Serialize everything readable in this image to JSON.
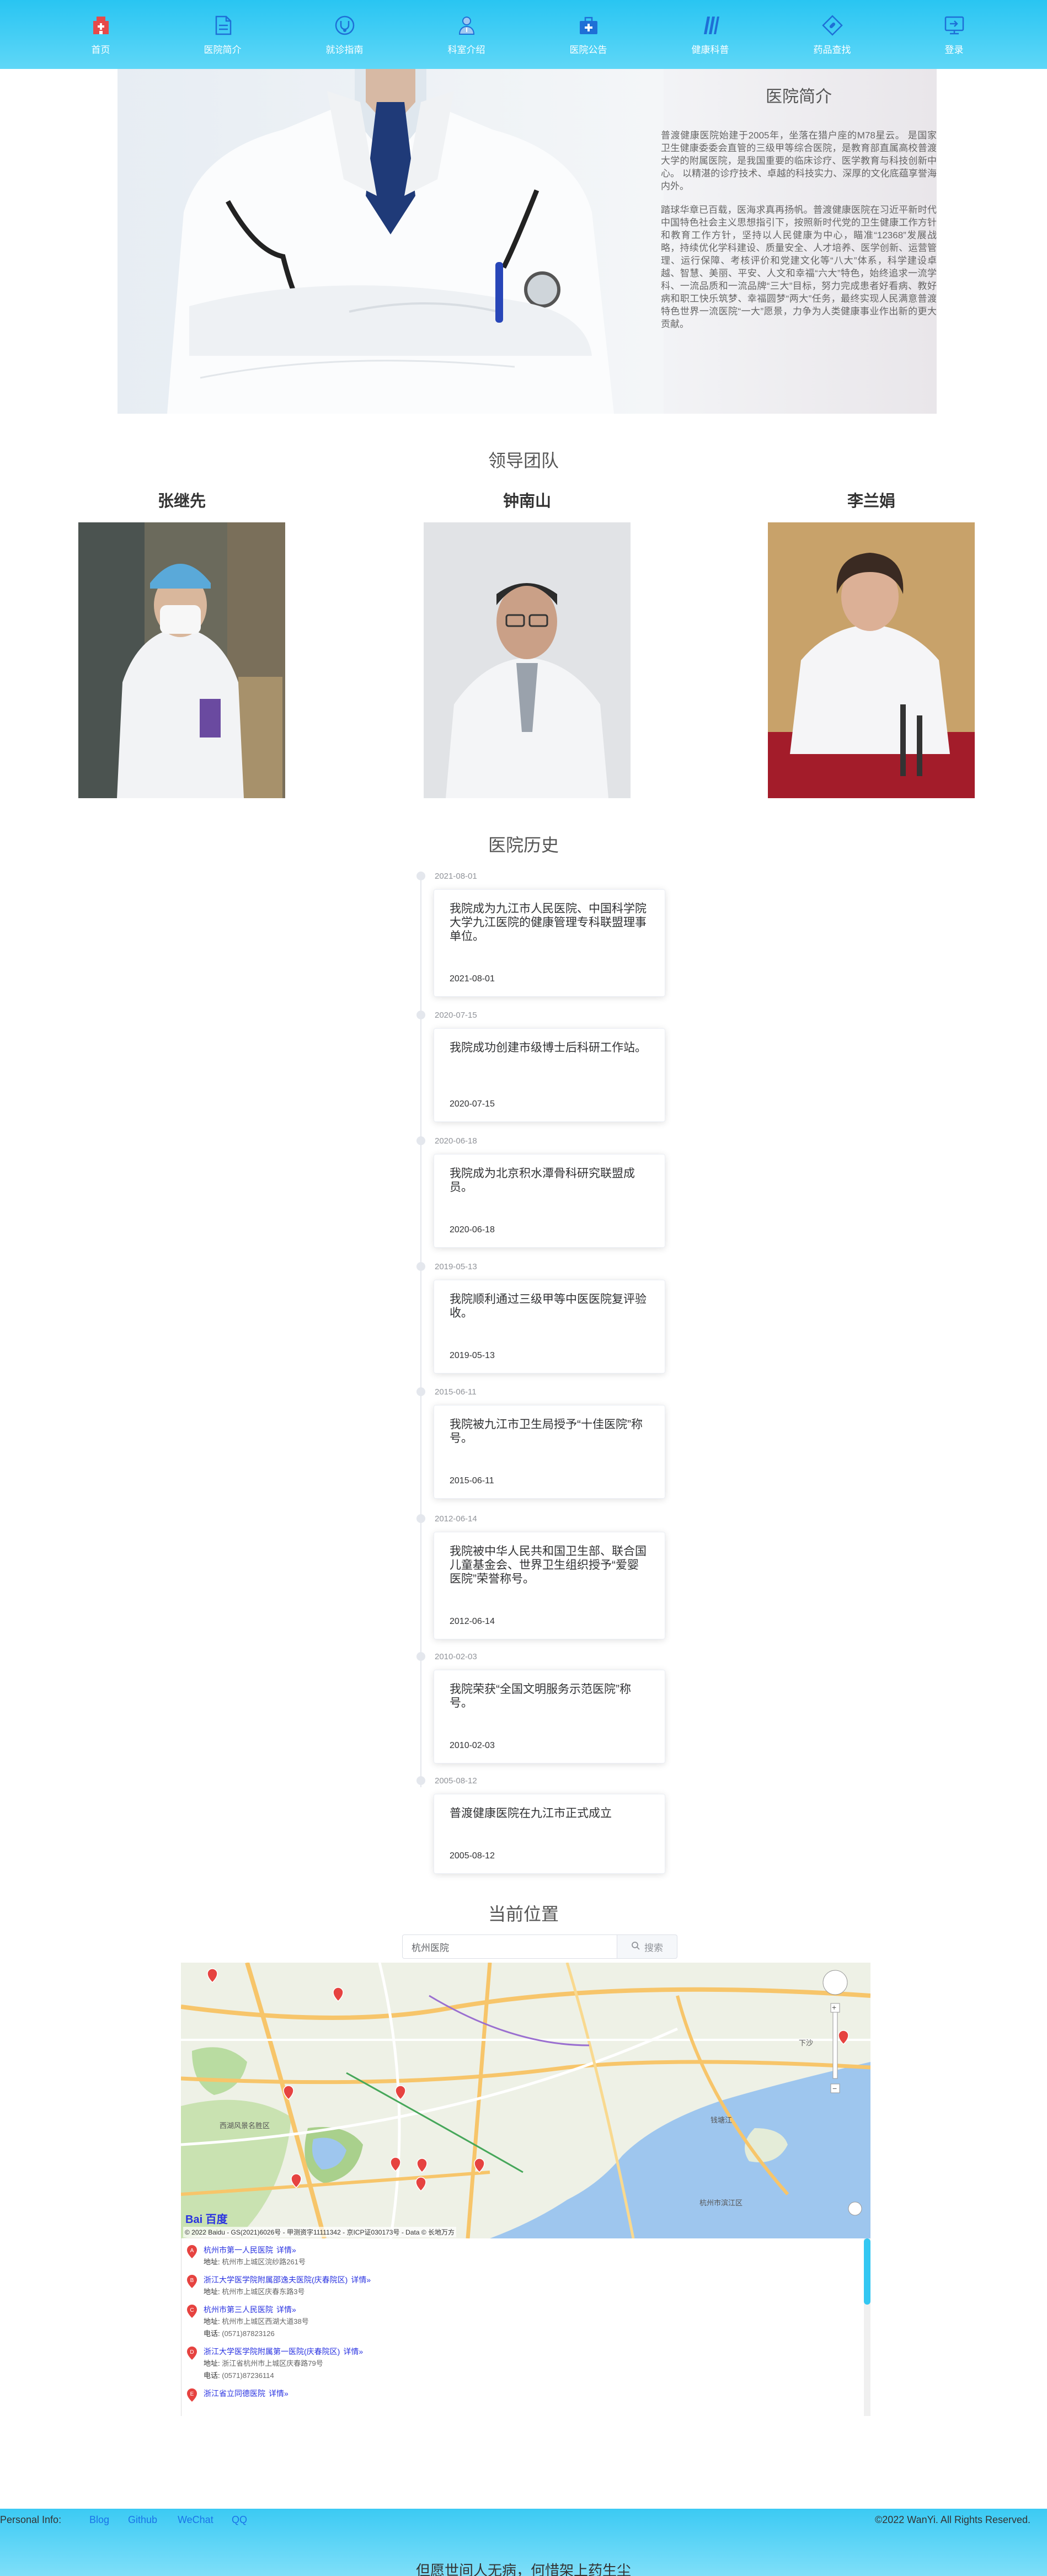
{
  "nav": {
    "items": [
      {
        "label": "首页",
        "icon": "hospital-icon",
        "color": "#e64a4a"
      },
      {
        "label": "医院简介",
        "icon": "document-icon",
        "color": "#1e88e5"
      },
      {
        "label": "就诊指南",
        "icon": "stethoscope-icon",
        "color": "#1e88e5"
      },
      {
        "label": "科室介绍",
        "icon": "doctor-icon",
        "color": "#1e88e5"
      },
      {
        "label": "医院公告",
        "icon": "medical-kit-icon",
        "color": "#1e88e5"
      },
      {
        "label": "健康科普",
        "icon": "books-icon",
        "color": "#1e88e5"
      },
      {
        "label": "药品查找",
        "icon": "pill-tag-icon",
        "color": "#1e88e5"
      },
      {
        "label": "登录",
        "icon": "login-icon",
        "color": "#1e88e5"
      }
    ]
  },
  "intro": {
    "title": "医院简介",
    "p1": "普渡健康医院始建于2005年，坐落在猎户座的M78星云。 是国家卫生健康委委会直管的三级甲等综合医院，是教育部直属高校普渡大学的附属医院，是我国重要的临床诊疗、医学教育与科技创新中心。 以精湛的诊疗技术、卓越的科技实力、深厚的文化底蕴享誉海内外。",
    "p2": "踏球华章已百载，医海求真再扬帆。普渡健康医院在习近平新时代中国特色社会主义思想指引下，按照新时代党的卫生健康工作方针和教育工作方针，坚持以人民健康为中心，瞄准“12368”发展战略，持续优化学科建设、质量安全、人才培养、医学创新、运营管理、运行保障、考核评价和党建文化等“八大”体系，科学建设卓越、智慧、美丽、平安、人文和幸福“六大”特色，始终追求一流学科、一流品质和一流品牌“三大”目标，努力完成患者好看病、教好病和职工快乐筑梦、幸福圆梦“两大”任务，最终实现人民满意普渡特色世界一流医院“一大”愿景，力争为人类健康事业作出新的更大贡献。"
  },
  "leaders": {
    "title": "领导团队",
    "list": [
      {
        "name": "张继先"
      },
      {
        "name": "钟南山"
      },
      {
        "name": "李兰娟"
      }
    ]
  },
  "history": {
    "title": "医院历史",
    "events": [
      {
        "date": "2021-08-01",
        "text": "我院成为九江市人民医院、中国科学院大学九江医院的健康管理专科联盟理事单位。"
      },
      {
        "date": "2020-07-15",
        "text": "我院成功创建市级博士后科研工作站。"
      },
      {
        "date": "2020-06-18",
        "text": "我院成为北京积水潭骨科研究联盟成员。"
      },
      {
        "date": "2019-05-13",
        "text": "我院顺利通过三级甲等中医医院复评验收。"
      },
      {
        "date": "2015-06-11",
        "text": "我院被九江市卫生局授予“十佳医院”称号。"
      },
      {
        "date": "2012-06-14",
        "text": "我院被中华人民共和国卫生部、联合国儿童基金会、世界卫生组织授予“爱婴医院”荣誉称号。"
      },
      {
        "date": "2010-02-03",
        "text": "我院荣获“全国文明服务示范医院”称号。"
      },
      {
        "date": "2005-08-12",
        "text": "普渡健康医院在九江市正式成立"
      }
    ]
  },
  "location": {
    "title": "当前位置",
    "search_value": "杭州医院",
    "search_button": "搜索",
    "map_copyright": "© 2022 Baidu - GS(2021)6026号 - 甲测资字11111342 - 京ICP证030173号 - Data © 长地万方",
    "map_logo": "Bai 百度",
    "map_labels": {
      "xihu": "西湖风景名胜区",
      "jiangbei": "杭州市滨江区",
      "xiasha": "下沙",
      "qiantang": "钱塘江"
    },
    "results": [
      {
        "marker": "A",
        "name": "杭州市第一人民医院",
        "more": "详情»",
        "address_label": "地址:",
        "address": "杭州市上城区浣纱路261号",
        "phone_label": "",
        "phone": ""
      },
      {
        "marker": "B",
        "name": "浙江大学医学院附属邵逸夫医院(庆春院区)",
        "more": "详情»",
        "address_label": "地址:",
        "address": "杭州市上城区庆春东路3号",
        "phone_label": "",
        "phone": ""
      },
      {
        "marker": "C",
        "name": "杭州市第三人民医院",
        "more": "详情»",
        "address_label": "地址:",
        "address": "杭州市上城区西湖大道38号",
        "phone_label": "电话:",
        "phone": "(0571)87823126"
      },
      {
        "marker": "D",
        "name": "浙江大学医学院附属第一医院(庆春院区)",
        "more": "详情»",
        "address_label": "地址:",
        "address": "浙江省杭州市上城区庆春路79号",
        "phone_label": "电话:",
        "phone": "(0571)87236114"
      },
      {
        "marker": "E",
        "name": "浙江省立同德医院",
        "more": "详情»",
        "address_label": "",
        "address": "",
        "phone_label": "",
        "phone": ""
      }
    ]
  },
  "footer": {
    "info_label": "Personal Info:",
    "links": [
      "Blog",
      "Github",
      "WeChat",
      "QQ"
    ],
    "copyright": "©2022 WanYi. All Rights Reserved.",
    "motto": "但愿世间人无病，何惜架上药生尘"
  }
}
